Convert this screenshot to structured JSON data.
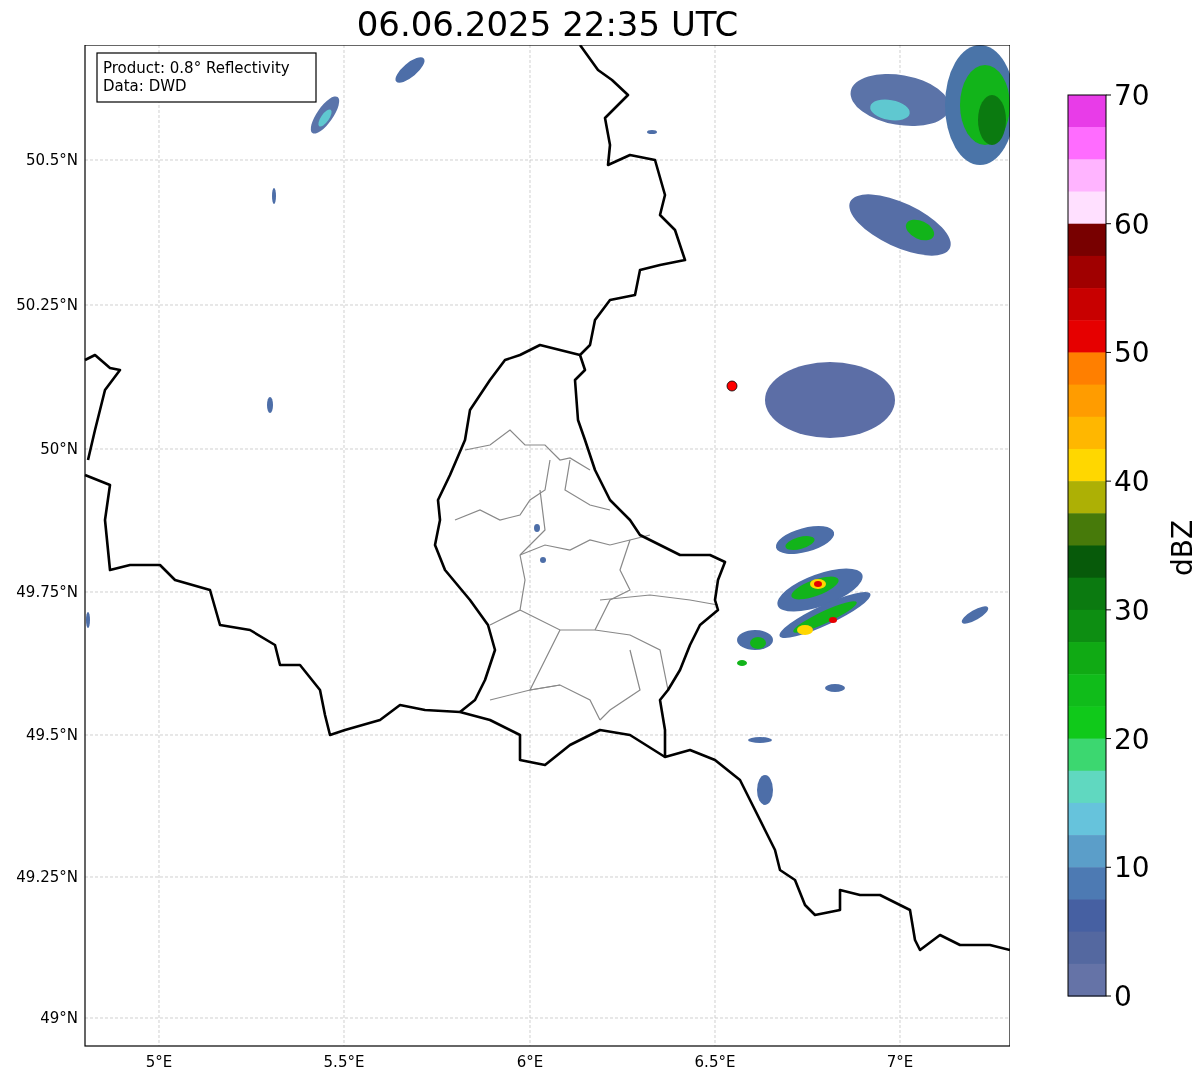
{
  "title": "06.06.2025 22:35 UTC",
  "info_box": {
    "lines": [
      "Product: 0.8° Reflectivity",
      "Data: DWD"
    ]
  },
  "map": {
    "lat_labels": [
      "50.5°N",
      "50.25°N",
      "50°N",
      "49.75°N",
      "49.5°N",
      "49.25°N",
      "49°N"
    ],
    "lon_labels": [
      "5°E",
      "5.5°E",
      "6°E",
      "6.5°E",
      "7°E"
    ]
  },
  "colorbar": {
    "label": "dBZ",
    "ticks": [
      "70",
      "60",
      "50",
      "40",
      "30",
      "20",
      "10",
      "0"
    ],
    "bins": [
      {
        "color": "#e83ce8"
      },
      {
        "color": "#ff6cff"
      },
      {
        "color": "#ffb4ff"
      },
      {
        "color": "#ffe0ff"
      },
      {
        "color": "#780000"
      },
      {
        "color": "#a00000"
      },
      {
        "color": "#c80000"
      },
      {
        "color": "#e60000"
      },
      {
        "color": "#ff7f00"
      },
      {
        "color": "#ff9c00"
      },
      {
        "color": "#ffb700"
      },
      {
        "color": "#ffd700"
      },
      {
        "color": "#adb005"
      },
      {
        "color": "#477a0a"
      },
      {
        "color": "#075a0a"
      },
      {
        "color": "#0b7a10"
      },
      {
        "color": "#0d8e12"
      },
      {
        "color": "#10aa14"
      },
      {
        "color": "#10bc1a"
      },
      {
        "color": "#10c91a"
      },
      {
        "color": "#3cd770"
      },
      {
        "color": "#60d8c0"
      },
      {
        "color": "#66c3dc"
      },
      {
        "color": "#5b9ec9"
      },
      {
        "color": "#4d7ab3"
      },
      {
        "color": "#4660a2"
      },
      {
        "color": "#5468a0"
      },
      {
        "color": "#6573a7"
      }
    ]
  }
}
